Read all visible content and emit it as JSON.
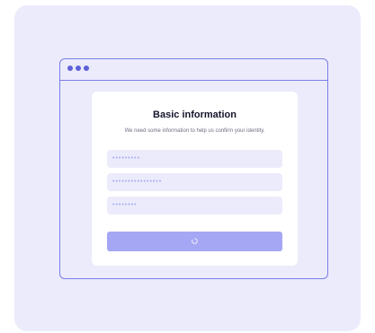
{
  "form": {
    "title": "Basic information",
    "subtitle": "We need some information to help us confirm your identity.",
    "fields": [
      {
        "value": "•••••••••"
      },
      {
        "value": "••••••••••••••••"
      },
      {
        "value": "••••••••"
      }
    ],
    "submit_state": "loading"
  },
  "colors": {
    "background": "#ebebfb",
    "accent": "#7b7de6",
    "button": "#a6a7f4"
  }
}
